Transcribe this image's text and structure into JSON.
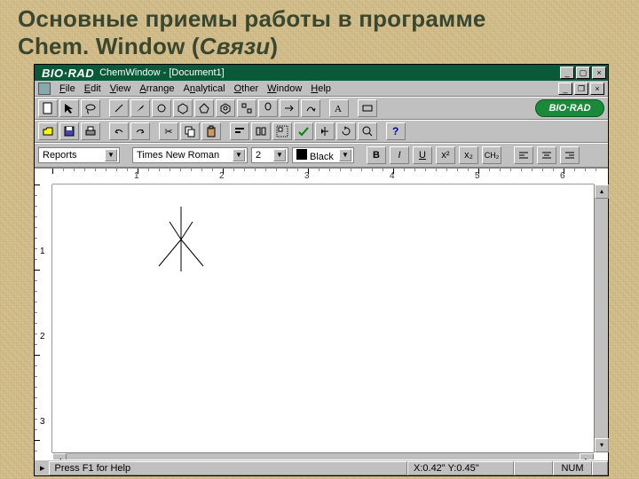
{
  "slide": {
    "title_line1": "Основные приемы работы в программе",
    "title_app": "Chem. Window",
    "title_paren_open": " (",
    "title_topic": "Связи",
    "title_paren_close": ")"
  },
  "window": {
    "logo_text": "BIO·RAD",
    "title": "ChemWindow - [Document1]",
    "brand_badge": "BIO·RAD"
  },
  "menu": {
    "file": "File",
    "edit": "Edit",
    "view": "View",
    "arrange": "Arrange",
    "analytical": "Analytical",
    "other": "Other",
    "window": "Window",
    "help": "Help"
  },
  "format": {
    "style_value": "Reports",
    "font_value": "Times New Roman",
    "size_value": "2",
    "color_label": "Black",
    "b": "B",
    "i": "I",
    "u": "U",
    "x2": "x²",
    "x2s": "x₂",
    "ch2": "CH₂"
  },
  "ruler": {
    "h_numbers": [
      "1",
      "2",
      "3",
      "4",
      "5",
      "6"
    ],
    "v_numbers": [
      "1",
      "2",
      "3"
    ]
  },
  "status": {
    "help": "Press F1 for Help",
    "coords": "X:0.42\" Y:0.45\"",
    "mode": "NUM"
  }
}
